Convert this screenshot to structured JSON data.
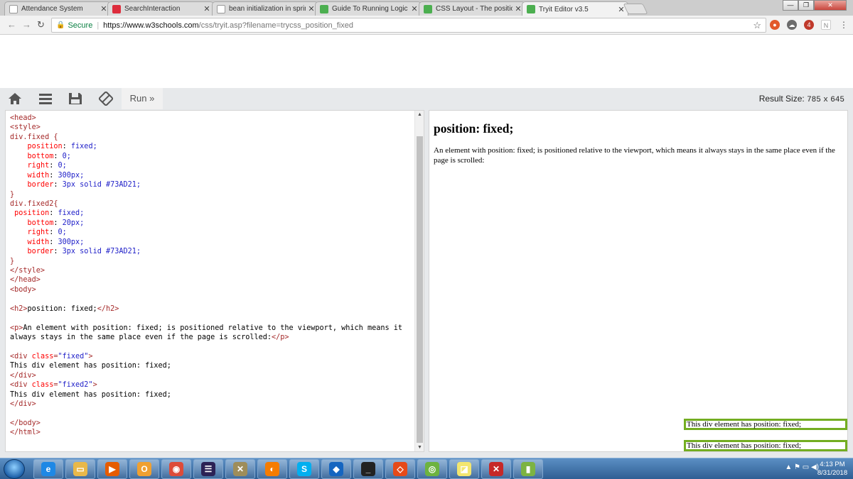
{
  "browser": {
    "tabs": [
      {
        "title": "Attendance System",
        "icon": "page-icon",
        "color": "#ffffff"
      },
      {
        "title": "SearchInteraction",
        "icon": "angular-icon",
        "color": "#dd2c3c"
      },
      {
        "title": "bean initialization in sprin",
        "icon": "google-icon",
        "color": "#ffffff"
      },
      {
        "title": "Guide To Running Logic",
        "icon": "notepad-icon",
        "color": "#4caf50"
      },
      {
        "title": "CSS Layout - The position",
        "icon": "w3schools-icon",
        "color": "#4caf50"
      },
      {
        "title": "Tryit Editor v3.5",
        "icon": "w3schools-icon",
        "color": "#4caf50"
      }
    ],
    "window_controls": [
      "minimize",
      "restore",
      "close"
    ],
    "secure_label": "Secure",
    "url_host": "https://www.w3schools.com",
    "url_path": "/css/tryit.asp?filename=trycss_position_fixed",
    "ext_badge": "4",
    "ext_label": "N"
  },
  "tryit": {
    "run_label": "Run »",
    "result_size_label": "Result Size:",
    "result_width": "785",
    "result_times": "x",
    "result_height": "645"
  },
  "code_lines": [
    [
      [
        "tag",
        "<head>"
      ]
    ],
    [
      [
        "tag",
        "<style>"
      ]
    ],
    [
      [
        "sel",
        "div.fixed {"
      ]
    ],
    [
      [
        "txt",
        "    "
      ],
      [
        "prop",
        "position"
      ],
      [
        "txt",
        ": "
      ],
      [
        "val",
        "fixed;"
      ]
    ],
    [
      [
        "txt",
        "    "
      ],
      [
        "prop",
        "bottom"
      ],
      [
        "txt",
        ": "
      ],
      [
        "val",
        "0;"
      ]
    ],
    [
      [
        "txt",
        "    "
      ],
      [
        "prop",
        "right"
      ],
      [
        "txt",
        ": "
      ],
      [
        "val",
        "0;"
      ]
    ],
    [
      [
        "txt",
        "    "
      ],
      [
        "prop",
        "width"
      ],
      [
        "txt",
        ": "
      ],
      [
        "val",
        "300px;"
      ]
    ],
    [
      [
        "txt",
        "    "
      ],
      [
        "prop",
        "border"
      ],
      [
        "txt",
        ": "
      ],
      [
        "val",
        "3px solid #73AD21;"
      ]
    ],
    [
      [
        "sel",
        "}"
      ]
    ],
    [
      [
        "sel",
        "div.fixed2{"
      ]
    ],
    [
      [
        "txt",
        " "
      ],
      [
        "prop",
        "position"
      ],
      [
        "txt",
        ": "
      ],
      [
        "val",
        "fixed;"
      ]
    ],
    [
      [
        "txt",
        "    "
      ],
      [
        "prop",
        "bottom"
      ],
      [
        "txt",
        ": "
      ],
      [
        "val",
        "20px;"
      ]
    ],
    [
      [
        "txt",
        "    "
      ],
      [
        "prop",
        "right"
      ],
      [
        "txt",
        ": "
      ],
      [
        "val",
        "0;"
      ]
    ],
    [
      [
        "txt",
        "    "
      ],
      [
        "prop",
        "width"
      ],
      [
        "txt",
        ": "
      ],
      [
        "val",
        "300px;"
      ]
    ],
    [
      [
        "txt",
        "    "
      ],
      [
        "prop",
        "border"
      ],
      [
        "txt",
        ": "
      ],
      [
        "val",
        "3px solid #73AD21;"
      ]
    ],
    [
      [
        "sel",
        "}"
      ]
    ],
    [
      [
        "tag",
        "</style>"
      ]
    ],
    [
      [
        "tag",
        "</head>"
      ]
    ],
    [
      [
        "tag",
        "<body>"
      ]
    ],
    [],
    [
      [
        "tag",
        "<h2>"
      ],
      [
        "txt",
        "position: fixed;"
      ],
      [
        "tag",
        "</h2>"
      ]
    ],
    [],
    [
      [
        "tag",
        "<p>"
      ],
      [
        "txt",
        "An element with position: fixed; is positioned relative to the viewport, which means it"
      ]
    ],
    [
      [
        "txt",
        "always stays in the same place even if the page is scrolled:"
      ],
      [
        "tag",
        "</p>"
      ]
    ],
    [],
    [
      [
        "tag",
        "<div "
      ],
      [
        "attr",
        "class"
      ],
      [
        "tag",
        "="
      ],
      [
        "str",
        "\"fixed\""
      ],
      [
        "tag",
        ">"
      ]
    ],
    [
      [
        "txt",
        "This div element has position: fixed;"
      ]
    ],
    [
      [
        "tag",
        "</div>"
      ]
    ],
    [
      [
        "tag",
        "<div "
      ],
      [
        "attr",
        "class"
      ],
      [
        "tag",
        "="
      ],
      [
        "str",
        "\"fixed2\""
      ],
      [
        "tag",
        ">"
      ]
    ],
    [
      [
        "txt",
        "This div element has position: fixed;"
      ]
    ],
    [
      [
        "tag",
        "</div>"
      ]
    ],
    [],
    [
      [
        "tag",
        "</body>"
      ]
    ],
    [
      [
        "tag",
        "</html>"
      ]
    ]
  ],
  "result": {
    "heading": "position: fixed;",
    "paragraph": "An element with position: fixed; is positioned relative to the viewport, which means it always stays in the same place even if the page is scrolled:",
    "fixed2_text": "This div element has position: fixed;",
    "fixed_text": "This div element has position: fixed;",
    "border_color": "#73AD21"
  },
  "taskbar": {
    "apps": [
      {
        "name": "internet-explorer-icon",
        "color": "#1e88e5",
        "glyph": "e"
      },
      {
        "name": "file-explorer-icon",
        "color": "#e8b84a",
        "glyph": "▭"
      },
      {
        "name": "media-player-icon",
        "color": "#e65c00",
        "glyph": "▶"
      },
      {
        "name": "outlook-icon",
        "color": "#f0a030",
        "glyph": "O"
      },
      {
        "name": "chrome-icon",
        "color": "#dd4b39",
        "glyph": "◉"
      },
      {
        "name": "eclipse-icon",
        "color": "#2c2255",
        "glyph": "☰"
      },
      {
        "name": "tools-icon",
        "color": "#9e8d5a",
        "glyph": "✕"
      },
      {
        "name": "firefox-icon",
        "color": "#f57c00",
        "glyph": "◐"
      },
      {
        "name": "skype-icon",
        "color": "#00aff0",
        "glyph": "S"
      },
      {
        "name": "visual-studio-icon",
        "color": "#1565c0",
        "glyph": "◆"
      },
      {
        "name": "terminal-icon",
        "color": "#222222",
        "glyph": "_"
      },
      {
        "name": "git-icon",
        "color": "#e64a19",
        "glyph": "◇"
      },
      {
        "name": "spring-icon",
        "color": "#6db33f",
        "glyph": "◎"
      },
      {
        "name": "stickies-icon",
        "color": "#f3e66f",
        "glyph": "◪"
      },
      {
        "name": "xml-tool-icon",
        "color": "#c62828",
        "glyph": "✕"
      },
      {
        "name": "profiler-icon",
        "color": "#7cb342",
        "glyph": "▮"
      }
    ],
    "time": "4:13 PM",
    "date": "8/31/2018"
  }
}
